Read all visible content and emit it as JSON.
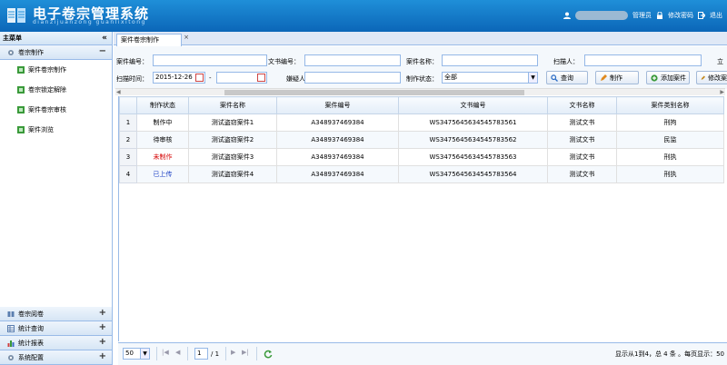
{
  "header": {
    "title": "电子卷宗管理系统",
    "subtitle": "dianzijuanzong guanlixitong",
    "home_label": "管理员",
    "change_password_label": "修改密码",
    "logout_label": "退出"
  },
  "sidebar": {
    "title": "主菜单",
    "collapse_glyph": "«",
    "active_section": {
      "label": "卷宗制作",
      "sign": "−",
      "items": [
        {
          "label": "案件卷宗制作"
        },
        {
          "label": "卷宗锁定解除"
        },
        {
          "label": "案件卷宗审核"
        },
        {
          "label": "案件浏览"
        }
      ]
    },
    "other_sections": [
      {
        "label": "卷宗阅卷",
        "sign": "+"
      },
      {
        "label": "统计查询",
        "sign": "+"
      },
      {
        "label": "统计报表",
        "sign": "+"
      },
      {
        "label": "系统配置",
        "sign": "+"
      }
    ]
  },
  "tab": {
    "label": "案件卷宗制作",
    "close": "×"
  },
  "search": {
    "case_no_label": "案件编号：",
    "case_no_value": "",
    "doc_no_label": "文书编号：",
    "doc_no_value": "",
    "case_name_label": "案件名称：",
    "case_name_value": "",
    "scanner_label": "扫描人：",
    "scanner_value": "",
    "extra_label": "立",
    "scan_time_label": "扫描时间：",
    "scan_time_from": "2015-12-26",
    "range_sep": "-",
    "scan_time_to": "",
    "suspect_label": "嫌疑人：",
    "suspect_value": "",
    "status_label": "制作状态：",
    "status_value": "全部",
    "buttons": {
      "query": "查询",
      "make": "制作",
      "add": "添加案件",
      "edit": "修改案"
    }
  },
  "grid": {
    "columns": [
      "",
      "制作状态",
      "案件名称",
      "案件编号",
      "文书编号",
      "文书名称",
      "案件类别名称"
    ],
    "rows": [
      {
        "n": "1",
        "status": "制作中",
        "status_color": "#000000",
        "case_name": "测试盗窃案件1",
        "case_no": "A348937469384",
        "doc_no": "WS3475645634545783561",
        "doc_name": "测试文书",
        "category": "刑拘"
      },
      {
        "n": "2",
        "status": "待审核",
        "status_color": "#000000",
        "case_name": "测试盗窃案件2",
        "case_no": "A348937469384",
        "doc_no": "WS3475645634545783562",
        "doc_name": "测试文书",
        "category": "民监"
      },
      {
        "n": "3",
        "status": "未制作",
        "status_color": "#d40000",
        "case_name": "测试盗窃案件3",
        "case_no": "A348937469384",
        "doc_no": "WS3475645634545783563",
        "doc_name": "测试文书",
        "category": "刑执"
      },
      {
        "n": "4",
        "status": "已上传",
        "status_color": "#1a3fc4",
        "case_name": "测试盗窃案件4",
        "case_no": "A348937469384",
        "doc_no": "WS3475645634545783564",
        "doc_name": "测试文书",
        "category": "刑执"
      }
    ]
  },
  "pager": {
    "page_size": "50",
    "first": "|◀",
    "prev": "◀",
    "page": "1",
    "total_pages": "/ 1",
    "next": "▶",
    "last": "▶|",
    "info": "显示从1到4，总 4 条 。每页显示：50"
  },
  "colors": {
    "brand": "#1f8fd8",
    "border": "#99bbe8"
  }
}
